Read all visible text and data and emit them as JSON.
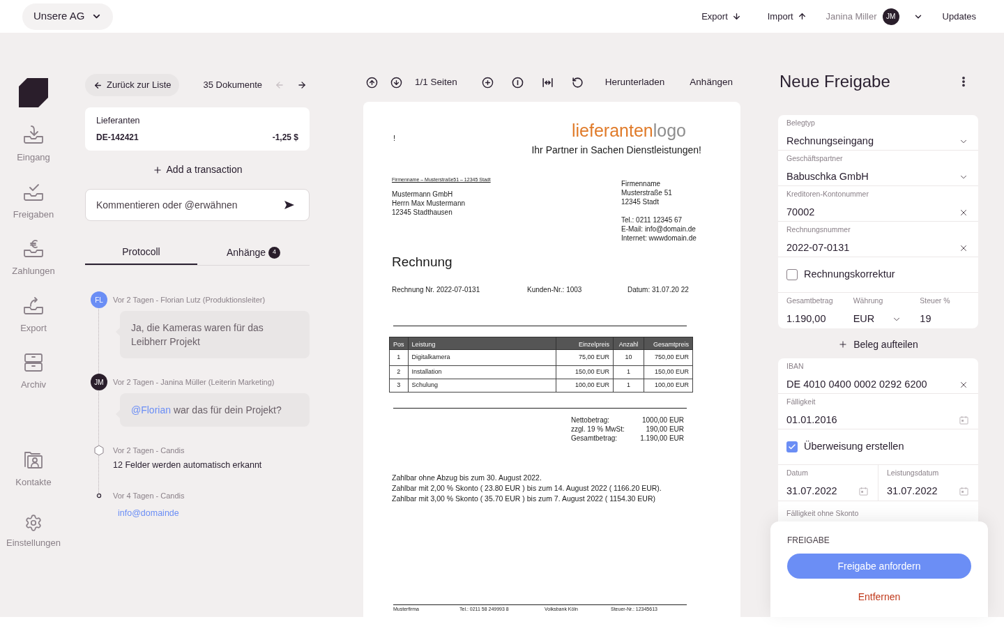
{
  "top_bar": {
    "company": "Unsere AG",
    "actions": [
      {
        "label": "Export",
        "kind": "down"
      },
      {
        "label": "Import",
        "kind": "up"
      }
    ],
    "user": {
      "name": "Janina Miller",
      "initials": "JM"
    },
    "updates": "Updates"
  },
  "sidebar": {
    "items": [
      {
        "label": "Eingang",
        "kind": "inbox"
      },
      {
        "label": "Freigaben",
        "kind": "approve"
      },
      {
        "label": "Zahlungen",
        "kind": "payment"
      },
      {
        "label": "Export",
        "kind": "export"
      },
      {
        "label": "Archiv",
        "kind": "archive"
      }
    ],
    "footer_items": [
      {
        "label": "Kontakte",
        "kind": "contacts"
      },
      {
        "label": "Einstellungen",
        "kind": "settings"
      }
    ]
  },
  "navigation": {
    "back": "Zurück zur Liste",
    "count": "35 Dokumente",
    "pager": [
      {
        "kind": "prev",
        "disabled": true
      },
      {
        "kind": "next",
        "disabled": false
      }
    ]
  },
  "transaction": {
    "title": "Lieferanten",
    "id": "DE-142421",
    "amount": "-1,25 $"
  },
  "add_transaction": "Add a transaction",
  "comment_field": {
    "placeholder": "Kommentieren oder @erwähnen"
  },
  "tabs": [
    {
      "label": "Protocoll",
      "selected": true
    },
    {
      "label": "Anhänge",
      "selected": false,
      "badge": "4"
    }
  ],
  "timeline": [
    {
      "kind": "comment",
      "initials": "FL",
      "color": "#6b8ef5",
      "meta": "Vor 2 Tagen - Florian Lutz (Produktionsleiter)",
      "text": "Ja, die Kameras waren für das Leibherr Projekt"
    },
    {
      "kind": "comment",
      "initials": "JM",
      "color": "#2a1e2b",
      "meta": "Vor 2 Tagen - Janina Müller (Leiterin Marketing)",
      "mention": "@Florian",
      "text": " war das für dein Projekt?"
    },
    {
      "kind": "system",
      "meta": "Vor 2 Tagen - Candis",
      "text": "12 Felder werden automatisch erkannt"
    },
    {
      "kind": "link",
      "meta": "Vor 4 Tagen - Candis",
      "text": "info@domainde"
    }
  ],
  "viewer": {
    "pages": "1/1 Seiten",
    "actions": [
      "Herunterladen",
      "Anhängen"
    ],
    "document": {
      "marker": "!",
      "logo_primary": "lieferanten",
      "logo_secondary": "logo",
      "slogan": "Ihr Partner in Sachen Dienstleistungen!",
      "sender_line": "Firmenname – Musterstraße51 – 12345 Stadt",
      "recipient": [
        "Mustermann GmbH",
        "Herrn Max Mustermann",
        "12345 Stadthausen"
      ],
      "sender": [
        "Firmenname",
        "Musterstraße 51",
        "12345 Stadt"
      ],
      "contact": [
        "Tel.: 0211 12345 67",
        "E-Mail: info@domain.de",
        "Internet: wwwdomain.de"
      ],
      "title": "Rechnung",
      "meta": [
        "Rechnung Nr. 2022-07-0131",
        "Kunden-Nr.: 1003",
        "Datum: 31.07.20 22"
      ],
      "table": {
        "columns": [
          "Pos",
          "Leistung",
          "Einzelpreis",
          "Anzahl",
          "Gesamtpreis"
        ],
        "rows": [
          [
            "1",
            "Digitalkamera",
            "75,00 EUR",
            "10",
            "750,00 EUR"
          ],
          [
            "2",
            "Installation",
            "150,00 EUR",
            "1",
            "150,00 EUR"
          ],
          [
            "3",
            "Schulung",
            "100,00 EUR",
            "1",
            "100,00 EUR"
          ]
        ]
      },
      "totals": [
        {
          "label": "Nettobetrag:",
          "value": "1000,00 EUR"
        },
        {
          "label": "zzgl. 19 % MwSt:",
          "value": "190,00 EUR"
        },
        {
          "label": "Gesamtbetrag:",
          "value": "1.190,00 EUR"
        }
      ],
      "terms": [
        "Zahlbar ohne Abzug bis zum 30. August 2022.",
        "Zahlbar mit 2,00 % Skonto ( 23.80 EUR ) bis zum 14. August 2022 ( 1166.20 EUR).",
        "Zahlbar mit 3,00 % Skonto ( 35.70 EUR ) bis zum 7. August 2022 ( 1154.30 EUR)"
      ],
      "footer": [
        "Musterfirma",
        "Tel.: 0211 58 249993 8",
        "Volksbank Köln",
        "Steuer-Nr.: 12345613"
      ]
    }
  },
  "approval": {
    "title": "Neue Freigabe",
    "sections": [
      [
        {
          "kind": "select",
          "label": "Belegtyp",
          "value": "Rechnungseingang"
        },
        {
          "kind": "clear-select",
          "label": "Geschäftspartner",
          "value": "Babuschka GmbH"
        },
        {
          "kind": "clear",
          "label": "Kreditoren-Kontonummer",
          "value": "70002"
        },
        {
          "kind": "clear",
          "label": "Rechnungsnummer",
          "value": "2022-07-0131"
        },
        {
          "kind": "check",
          "label": "Rechnungskorrektur",
          "checked": false
        },
        {
          "kind": "group",
          "fields": [
            {
              "kind": "text",
              "label": "Gesamtbetrag",
              "value": "1.190,00"
            },
            {
              "kind": "select",
              "label": "Währung",
              "value": "EUR"
            },
            {
              "kind": "text",
              "label": "Steuer %",
              "value": "19"
            }
          ]
        }
      ],
      [
        {
          "kind": "clear",
          "label": "IBAN",
          "value": "DE 4010 0400 0002 0292 6200"
        },
        {
          "kind": "date",
          "label": "Fälligkeit",
          "value": "01.01.2016"
        },
        {
          "kind": "check",
          "label": "Überweisung erstellen",
          "checked": true
        },
        {
          "kind": "group",
          "fields": [
            {
              "kind": "date",
              "label": "Datum",
              "value": "31.07.2022"
            },
            {
              "kind": "date",
              "label": "Leistungsdatum",
              "value": "31.07.2022"
            }
          ]
        },
        {
          "kind": "label",
          "label": "Fälligkeit ohne Skonto"
        }
      ]
    ],
    "split": "Beleg aufteilen",
    "footer": {
      "heading": "FREIGABE",
      "primary": "Freigabe anfordern",
      "secondary": "Entfernen"
    }
  }
}
